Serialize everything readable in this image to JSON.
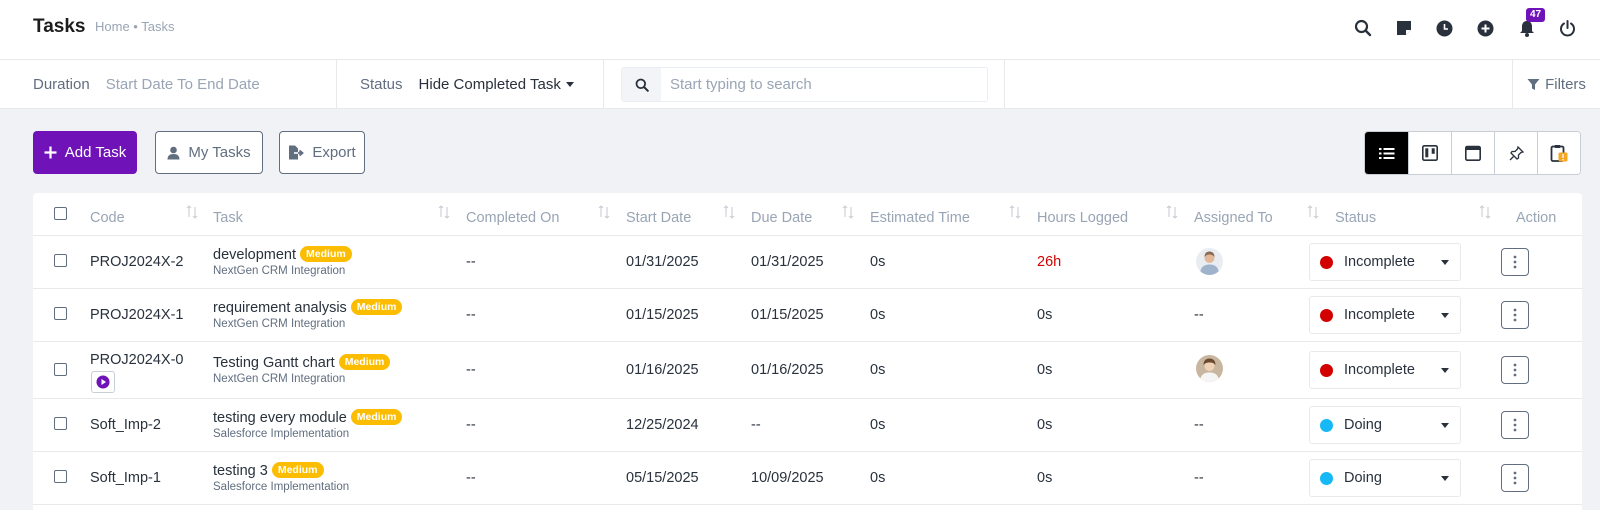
{
  "header": {
    "title": "Tasks",
    "breadcrumb": "Home • Tasks",
    "notification_count": "47",
    "icons": [
      "search-icon",
      "sticky-note-icon",
      "clock-icon",
      "plus-circle-icon",
      "bell-icon",
      "power-icon"
    ]
  },
  "filters": {
    "duration_label": "Duration",
    "duration_value": "Start Date To End Date",
    "status_label": "Status",
    "status_value": "Hide Completed Task",
    "search_placeholder": "Start typing to search",
    "filters_label": "Filters"
  },
  "actions": {
    "add_task": "Add Task",
    "my_tasks": "My Tasks",
    "export": "Export"
  },
  "views": [
    "list-view-icon",
    "kanban-view-icon",
    "calendar-view-icon",
    "pinned-view-icon",
    "waiting-approval-icon"
  ],
  "colors": {
    "brand": "#6f13b8",
    "incomplete": "#d30000",
    "doing": "#16b9f5",
    "priority_medium": "#fcbd01"
  },
  "table": {
    "columns": [
      "Code",
      "Task",
      "Completed On",
      "Start Date",
      "Due Date",
      "Estimated Time",
      "Hours Logged",
      "Assigned To",
      "Status",
      "Action"
    ],
    "rows": [
      {
        "code": "PROJ2024X-2",
        "task": "development",
        "priority": "Medium",
        "project": "NextGen CRM Integration",
        "completed_on": "--",
        "start": "01/31/2025",
        "due": "01/31/2025",
        "estimated": "0s",
        "hours": "26h",
        "assigned": "",
        "status": "Incomplete"
      },
      {
        "code": "PROJ2024X-1",
        "task": "requirement analysis",
        "priority": "Medium",
        "project": "NextGen CRM Integration",
        "completed_on": "--",
        "start": "01/15/2025",
        "due": "01/15/2025",
        "estimated": "0s",
        "hours": "0s",
        "assigned": "--",
        "status": "Incomplete"
      },
      {
        "code": "PROJ2024X-0",
        "task": "Testing Gantt chart",
        "priority": "Medium",
        "project": "NextGen CRM Integration",
        "completed_on": "--",
        "start": "01/16/2025",
        "due": "01/16/2025",
        "estimated": "0s",
        "hours": "0s",
        "assigned": "",
        "status": "Incomplete"
      },
      {
        "code": "Soft_Imp-2",
        "task": "testing every module",
        "priority": "Medium",
        "project": "Salesforce Implementation",
        "completed_on": "--",
        "start": "12/25/2024",
        "due": "--",
        "estimated": "0s",
        "hours": "0s",
        "assigned": "--",
        "status": "Doing"
      },
      {
        "code": "Soft_Imp-1",
        "task": "testing 3",
        "priority": "Medium",
        "project": "Salesforce Implementation",
        "completed_on": "--",
        "start": "05/15/2025",
        "due": "10/09/2025",
        "estimated": "0s",
        "hours": "0s",
        "assigned": "--",
        "status": "Doing"
      }
    ]
  }
}
